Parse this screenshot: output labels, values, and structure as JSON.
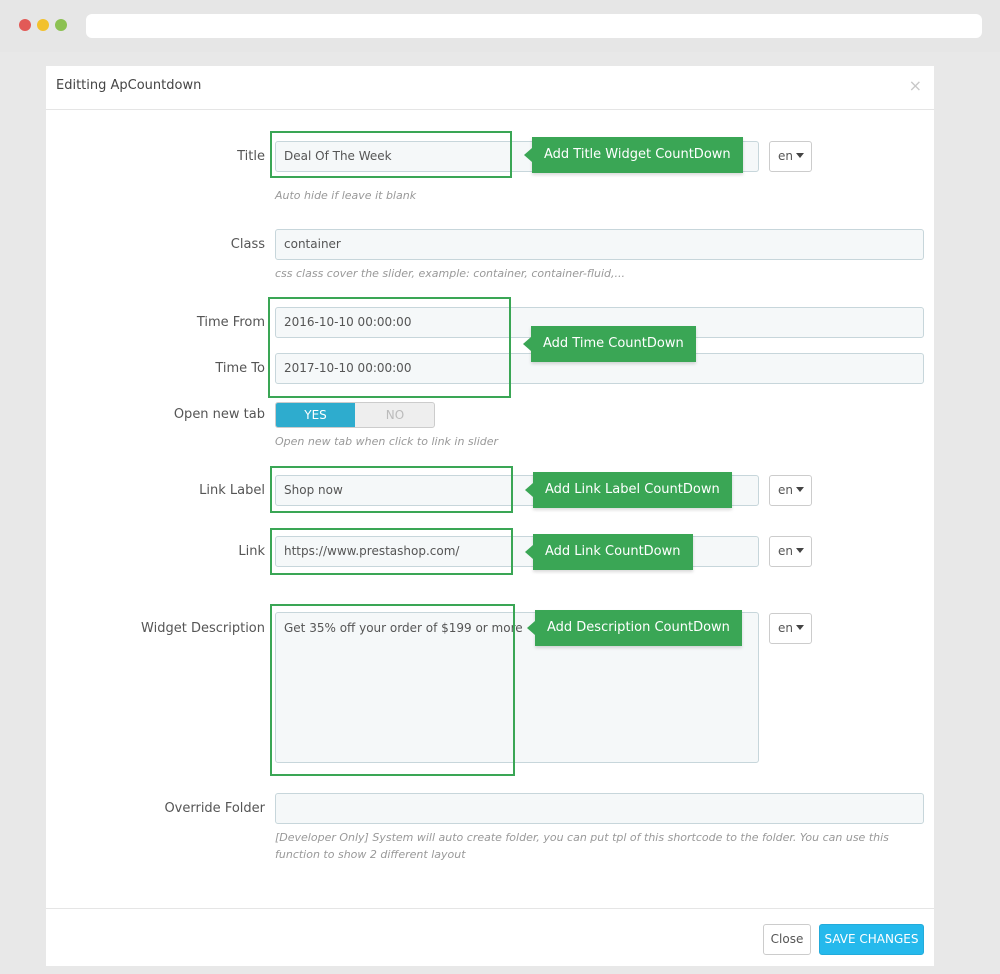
{
  "modal": {
    "title": "Editting ApCountdown",
    "close_glyph": "×"
  },
  "fields": {
    "title": {
      "label": "Title",
      "value": "Deal Of The Week",
      "lang": "en",
      "help": "Auto hide if leave it blank"
    },
    "class": {
      "label": "Class",
      "value": "container",
      "help": "css class cover the slider, example: container, container-fluid,..."
    },
    "time_from": {
      "label": "Time From",
      "value": "2016-10-10 00:00:00"
    },
    "time_to": {
      "label": "Time To",
      "value": "2017-10-10 00:00:00"
    },
    "open_new_tab": {
      "label": "Open new tab",
      "yes": "YES",
      "no": "NO",
      "selected": "YES",
      "help": "Open new tab when click to link in slider"
    },
    "link_label": {
      "label": "Link Label",
      "value": "Shop now",
      "lang": "en"
    },
    "link": {
      "label": "Link",
      "value": "https://www.prestashop.com/",
      "lang": "en"
    },
    "description": {
      "label": "Widget Description",
      "value": "Get 35% off your order of $199 or more",
      "lang": "en"
    },
    "override_folder": {
      "label": "Override Folder",
      "value": "",
      "help": "[Developer Only] System will auto create folder, you can put tpl of this shortcode to the folder. You can use this function to show 2 different layout"
    }
  },
  "callouts": {
    "title": "Add Title Widget CountDown",
    "time": "Add Time CountDown",
    "link_label": "Add Link Label CountDown",
    "link": "Add Link CountDown",
    "description": "Add Description CountDown"
  },
  "footer": {
    "close_label": "Close",
    "save_label": "SAVE CHANGES"
  },
  "colors": {
    "callout_green": "#3aa655",
    "toggle_yes": "#2eacce",
    "save_button": "#25b9ec"
  }
}
